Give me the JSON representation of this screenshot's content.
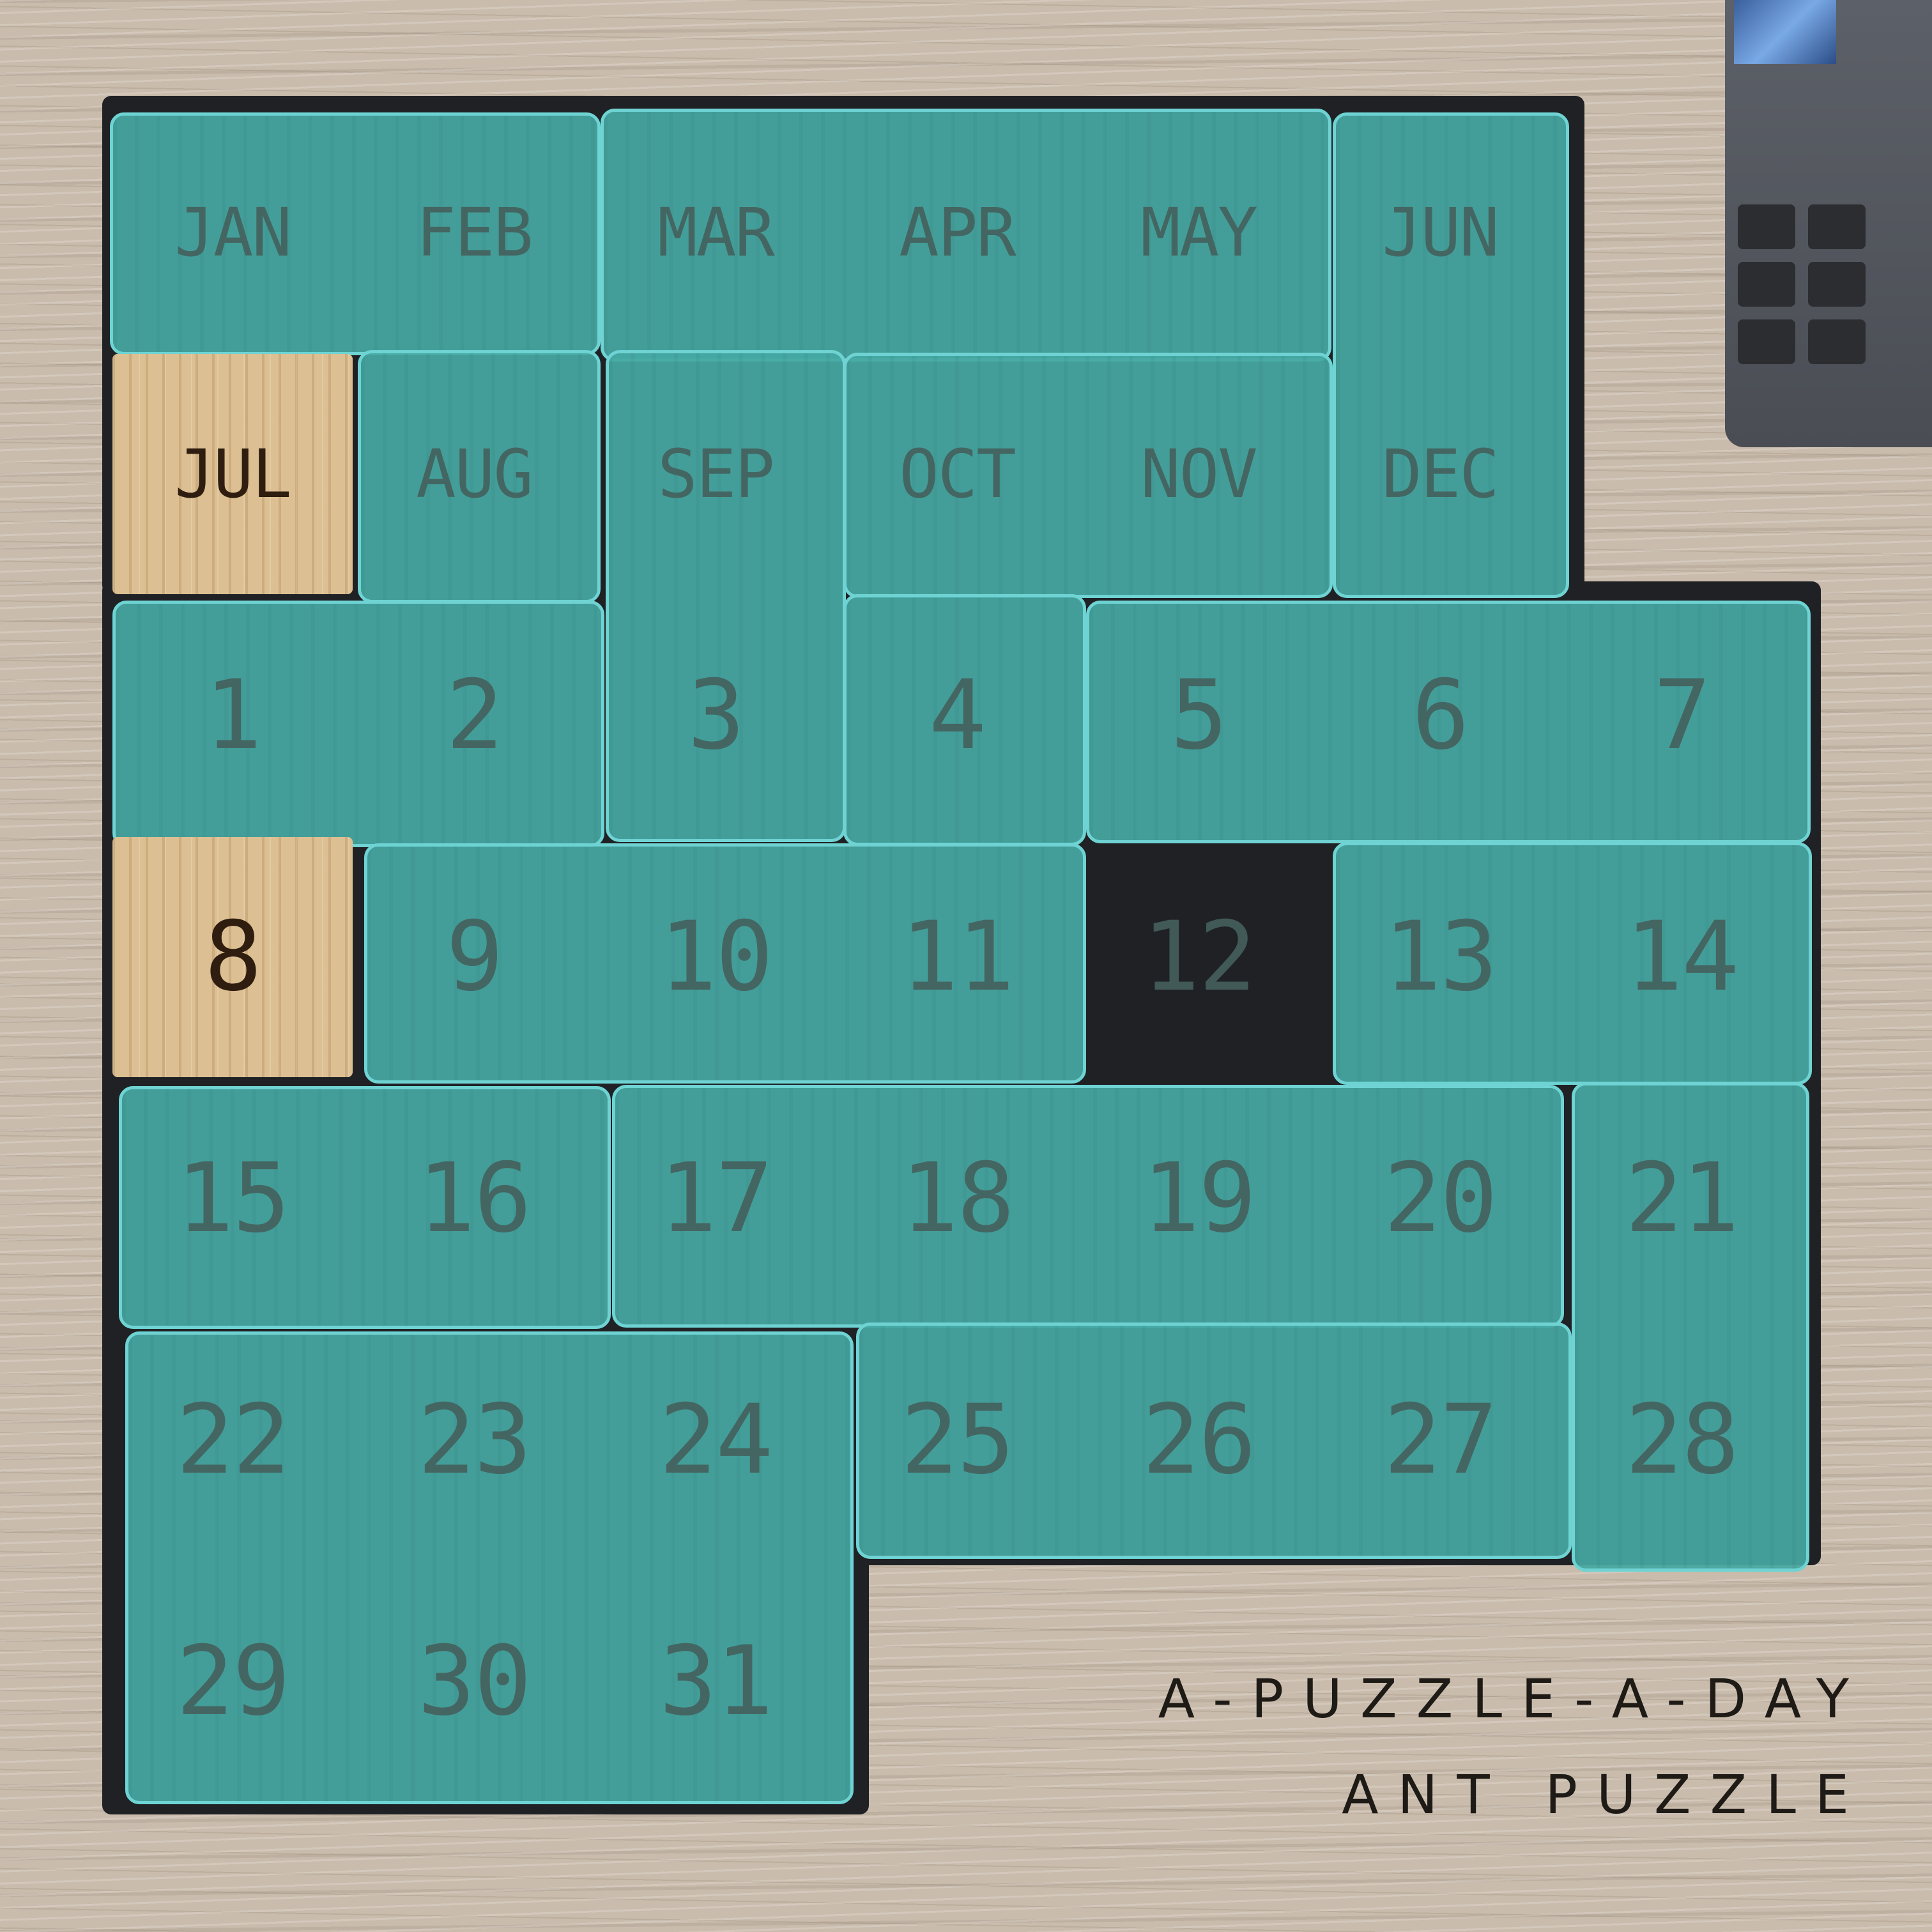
{
  "months": [
    "JAN",
    "FEB",
    "MAR",
    "APR",
    "MAY",
    "JUN",
    "JUL",
    "AUG",
    "SEP",
    "OCT",
    "NOV",
    "DEC"
  ],
  "days": [
    "1",
    "2",
    "3",
    "4",
    "5",
    "6",
    "7",
    "8",
    "9",
    "10",
    "11",
    "12",
    "13",
    "14",
    "15",
    "16",
    "17",
    "18",
    "19",
    "20",
    "21",
    "22",
    "23",
    "24",
    "25",
    "26",
    "27",
    "28",
    "29",
    "30",
    "31"
  ],
  "uncovered_cells": [
    "JUL",
    "8"
  ],
  "brand_line1": "A-PUZZLE-A-DAY",
  "brand_line2": "ANT PUZZLE",
  "colors": {
    "piece": "#46a8a3",
    "piece_edge": "#6fd3d3",
    "wood": "#c9bcac",
    "open_cell_wood": "#dcbf92",
    "well": "#1f2124"
  },
  "icons": [
    "laptop-corner"
  ]
}
